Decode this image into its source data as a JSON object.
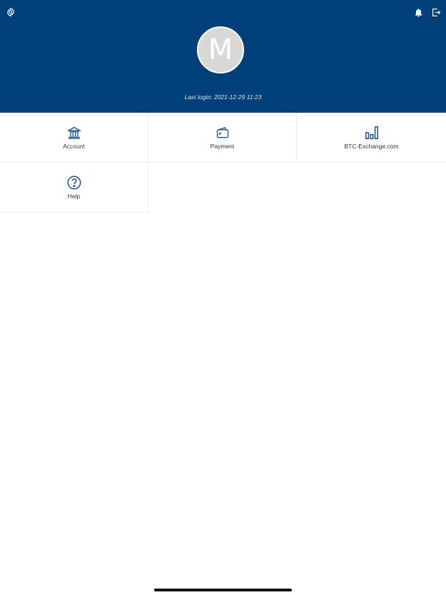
{
  "header": {
    "avatar_initial": "M",
    "last_login": "Last login: 2021-12-29 11:23",
    "background_color": "#00417c"
  },
  "toolbar": {
    "settings_icon": "gear-icon",
    "notifications_icon": "bell-icon",
    "logout_icon": "logout-icon"
  },
  "menu": {
    "items": [
      {
        "label": "Account",
        "icon": "bank-icon"
      },
      {
        "label": "Payment",
        "icon": "wallet-icon"
      },
      {
        "label": "BTC-Exchange.com",
        "icon": "bar-chart-icon"
      },
      {
        "label": "Help",
        "icon": "help-circle-icon"
      }
    ]
  },
  "colors": {
    "accent": "#1f4e8c"
  }
}
